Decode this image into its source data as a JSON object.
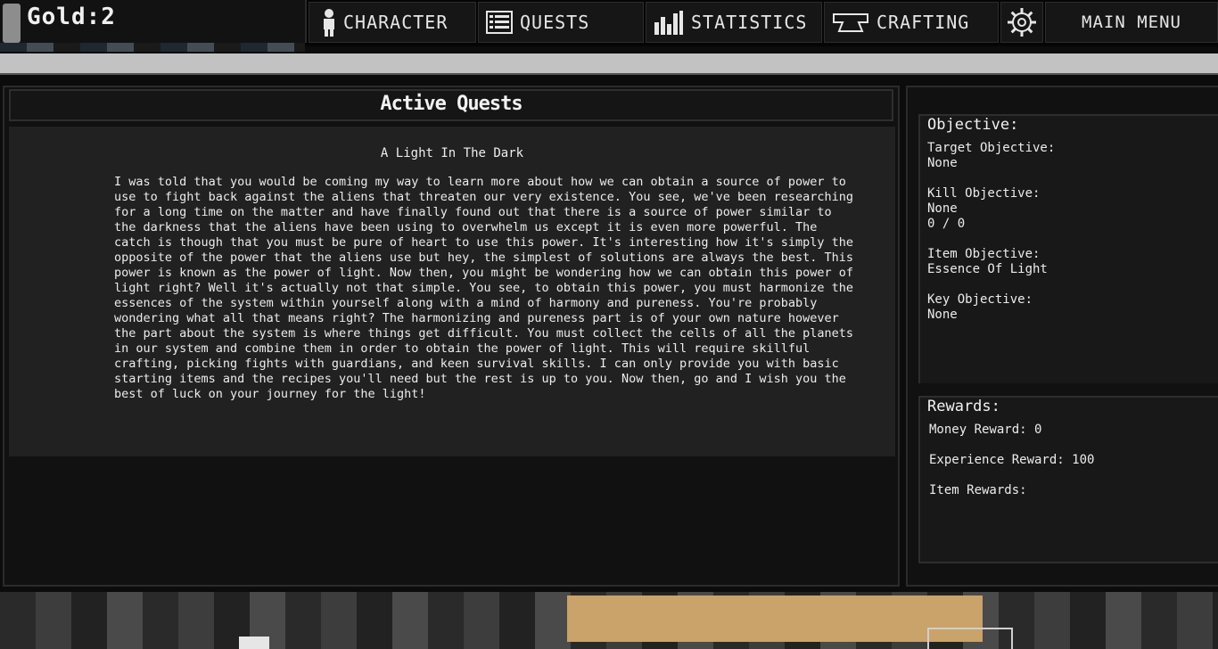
{
  "hud": {
    "gold_label": "Gold:2"
  },
  "nav": {
    "character": "CHARACTER",
    "quests": "QUESTS",
    "statistics": "STATISTICS",
    "crafting": "CRAFTING",
    "main_menu": "MAIN MENU"
  },
  "icons": {
    "character": "person-icon",
    "quests": "list-icon",
    "statistics": "bar-chart-icon",
    "crafting": "anvil-icon",
    "settings": "gear-icon"
  },
  "progress": {
    "value": 1.0
  },
  "quest_panel": {
    "header": "Active Quests",
    "title": "A Light In The Dark",
    "description": "I was told that you would be coming my way to learn more about how we can obtain a source of power to use to fight back against the aliens that threaten our very existence. You see, we've been researching for a long time on the matter and have finally found out that there is a source of power similar to the darkness that the aliens have been using to overwhelm us except it is even more powerful. The catch is though that you must be pure of heart to use this power. It's interesting how it's simply the opposite of the power that the aliens use but hey, the simplest of solutions are always the best. This power is known as the power of light. Now then, you might be wondering how we can obtain this power of light right? Well it's actually not that simple. You see, to obtain this power, you must harmonize the essences of the system within yourself along with a mind of harmony and pureness. You're probably wondering what all that means right? The harmonizing and pureness part is of your own nature however the part about the system is where things get difficult. You must collect the cells of all the planets in our system and combine them in order to obtain the power of light. This will require skillful crafting, picking fights with guardians, and keen survival skills. I can only provide you with basic starting items and the recipes you'll need but the rest is up to you. Now then, go and I wish you the best of luck on your journey for the light!"
  },
  "objective": {
    "heading": "Objective:",
    "target_label": "Target Objective:",
    "target_value": "None",
    "kill_label": "Kill Objective:",
    "kill_value": "None",
    "kill_count": "0 / 0",
    "item_label": "Item Objective:",
    "item_value": "Essence Of Light",
    "key_label": "Key Objective:",
    "key_value": "None"
  },
  "rewards": {
    "heading": "Rewards:",
    "money": "Money Reward: 0",
    "experience": "Experience Reward: 100",
    "items": "Item Rewards:"
  }
}
